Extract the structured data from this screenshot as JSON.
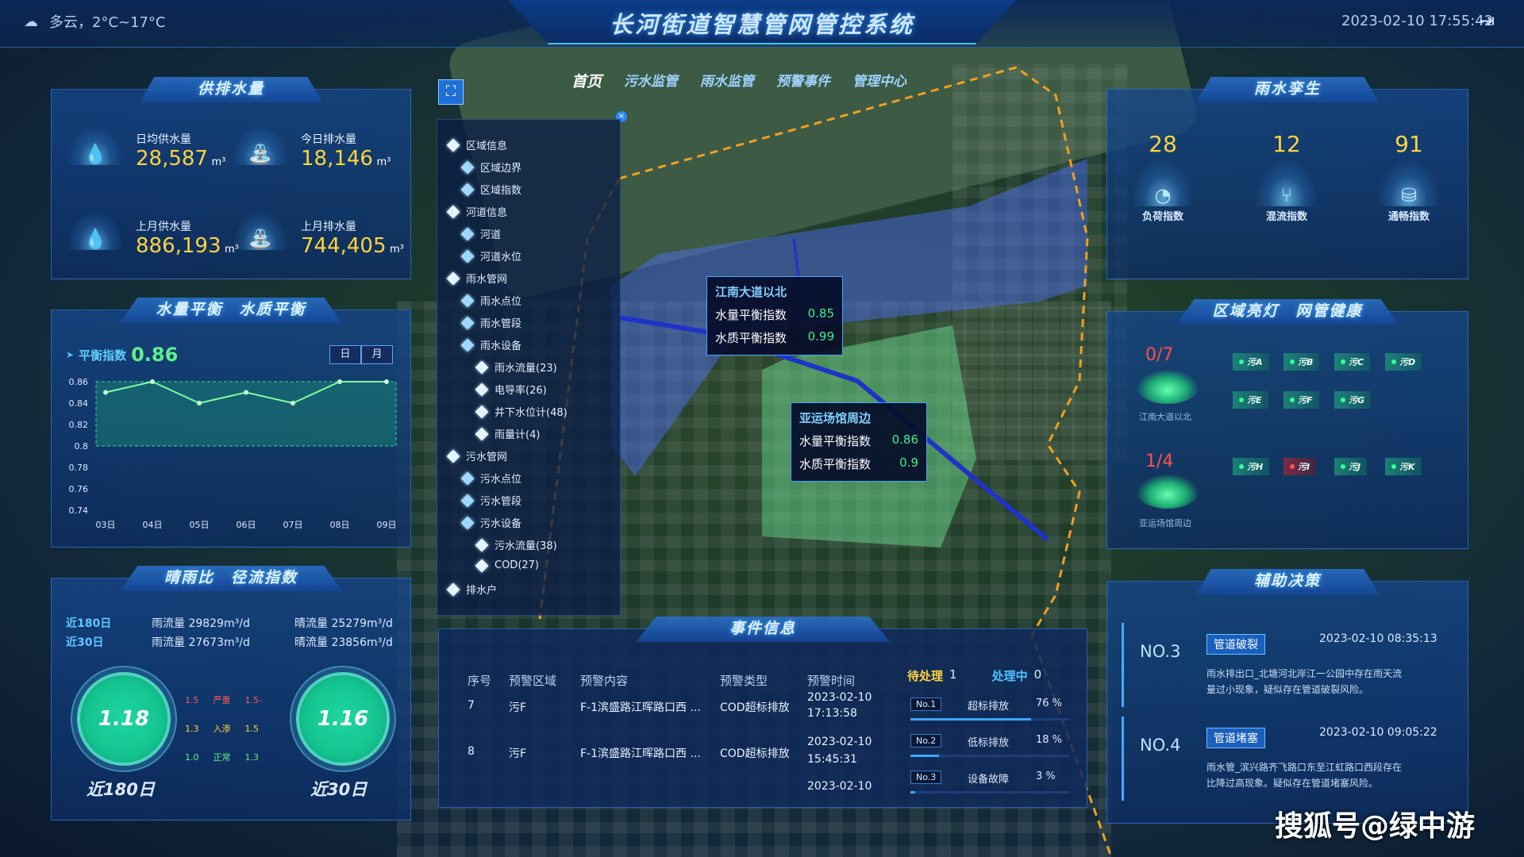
{
  "header": {
    "weather": "多云，2°C~17°C",
    "title": "长河街道智慧管网管控系统",
    "datetime": "2023-02-10 17:55:42"
  },
  "nav": [
    "首页",
    "污水监管",
    "雨水监管",
    "预警事件",
    "管理中心"
  ],
  "supply": {
    "title": "供排水量",
    "items": [
      {
        "label": "日均供水量",
        "value": "28,587",
        "unit": "m³"
      },
      {
        "label": "今日排水量",
        "value": "18,146",
        "unit": "m³"
      },
      {
        "label": "上月供水量",
        "value": "886,193",
        "unit": "m³"
      },
      {
        "label": "上月排水量",
        "value": "744,405",
        "unit": "m³"
      }
    ]
  },
  "balance": {
    "title": "水量平衡　水质平衡",
    "index_label": "平衡指数",
    "index_value": "0.86",
    "btn_day": "日",
    "btn_month": "月"
  },
  "chart_data": {
    "type": "area",
    "x": [
      "03日",
      "04日",
      "05日",
      "06日",
      "07日",
      "08日",
      "09日"
    ],
    "y_ticks": [
      "0.86",
      "0.84",
      "0.82",
      "0.8",
      "0.78",
      "0.76",
      "0.74"
    ],
    "ylim": [
      0.74,
      0.86
    ],
    "series": [
      {
        "values": [
          0.85,
          0.86,
          0.84,
          0.85,
          0.84,
          0.86,
          0.86
        ]
      }
    ]
  },
  "rain": {
    "title": "晴雨比　径流指数",
    "rows": [
      {
        "label": "近180日",
        "rain": "雨流量 29829m³/d",
        "clear": "晴流量 25279m³/d"
      },
      {
        "label": "近30日",
        "rain": "雨流量 27673m³/d",
        "clear": "晴流量 23856m³/d"
      }
    ],
    "c1": "1.18",
    "c2": "1.16",
    "c1_label": "近180日",
    "c2_label": "近30日",
    "legend": [
      [
        "1.5",
        "严重",
        "1.5-"
      ],
      [
        "1.3",
        "入渗",
        "1.5"
      ],
      [
        "1.0",
        "正常",
        "1.3"
      ]
    ]
  },
  "tree": [
    "区域信息",
    "区域边界",
    "区域指数",
    "河道信息",
    "河道",
    "河道水位",
    "雨水管网",
    "雨水点位",
    "雨水管段",
    "雨水设备",
    "雨水流量(23)",
    "电导率(26)",
    "井下水位计(48)",
    "雨量计(4)",
    "污水管网",
    "污水点位",
    "污水管段",
    "污水设备",
    "污水流量(38)",
    "COD(27)",
    "排水户"
  ],
  "popup1": {
    "title": "江南大道以北",
    "r1": "水量平衡指数",
    "v1": "0.85",
    "r2": "水质平衡指数",
    "v2": "0.99"
  },
  "popup2": {
    "title": "亚运场馆周边",
    "r1": "水量平衡指数",
    "v1": "0.86",
    "r2": "水质平衡指数",
    "v2": "0.9"
  },
  "events": {
    "title": "事件信息",
    "headers": [
      "序号",
      "预警区域",
      "预警内容",
      "预警类型",
      "预警时间"
    ],
    "rows": [
      {
        "no": "7",
        "area": "污F",
        "content": "F-1滨盛路江晖路口西 ...",
        "type": "COD超标排放",
        "time1": "2023-02-10",
        "time2": "17:13:58"
      },
      {
        "no": "8",
        "area": "污F",
        "content": "F-1滨盛路江晖路口西 ...",
        "type": "COD超标排放",
        "time1": "2023-02-10",
        "time2": "15:45:31"
      },
      {
        "no": "",
        "area": "",
        "content": "",
        "type": "",
        "time1": "2023-02-10",
        "time2": ""
      }
    ],
    "pending_label": "待处理",
    "pending": "1",
    "processing_label": "处理中",
    "processing": "0",
    "rank": [
      {
        "no": "No.1",
        "label": "超标排放",
        "pct": "76 %",
        "v": 0.76
      },
      {
        "no": "No.2",
        "label": "低标排放",
        "pct": "18 %",
        "v": 0.18
      },
      {
        "no": "No.3",
        "label": "设备故障",
        "pct": "3 %",
        "v": 0.03
      }
    ]
  },
  "twin": {
    "title": "雨水孪生",
    "items": [
      {
        "v": "28",
        "label": "负荷指数"
      },
      {
        "v": "12",
        "label": "混流指数"
      },
      {
        "v": "91",
        "label": "通畅指数"
      }
    ]
  },
  "lights": {
    "title": "区域亮灯　网管健康",
    "a_ratio": "0/7",
    "a_name": "江南大道以北",
    "b_ratio": "1/4",
    "b_name": "亚运场馆周边",
    "row1": [
      "污A",
      "污B",
      "污C",
      "污D"
    ],
    "row2": [
      "污E",
      "污F",
      "污G"
    ],
    "row3": [
      "污H",
      "污I",
      "污J",
      "污K"
    ]
  },
  "decision": {
    "title": "辅助决策",
    "items": [
      {
        "no": "NO.3",
        "tag": "管道破裂",
        "time": "2023-02-10 08:35:13",
        "t1": "雨水排出口_北塘河北岸江一公园中存在雨天流",
        "t2": "量过小现象，疑似存在管道破裂风险。"
      },
      {
        "no": "NO.4",
        "tag": "管道堵塞",
        "time": "2023-02-10 09:05:22",
        "t1": "雨水管_滨兴路齐飞路口东至江虹路口西段存在",
        "t2": "比降过高现象。疑似存在管道堵塞风险。"
      }
    ]
  },
  "watermark": "搜狐号@绿中游"
}
